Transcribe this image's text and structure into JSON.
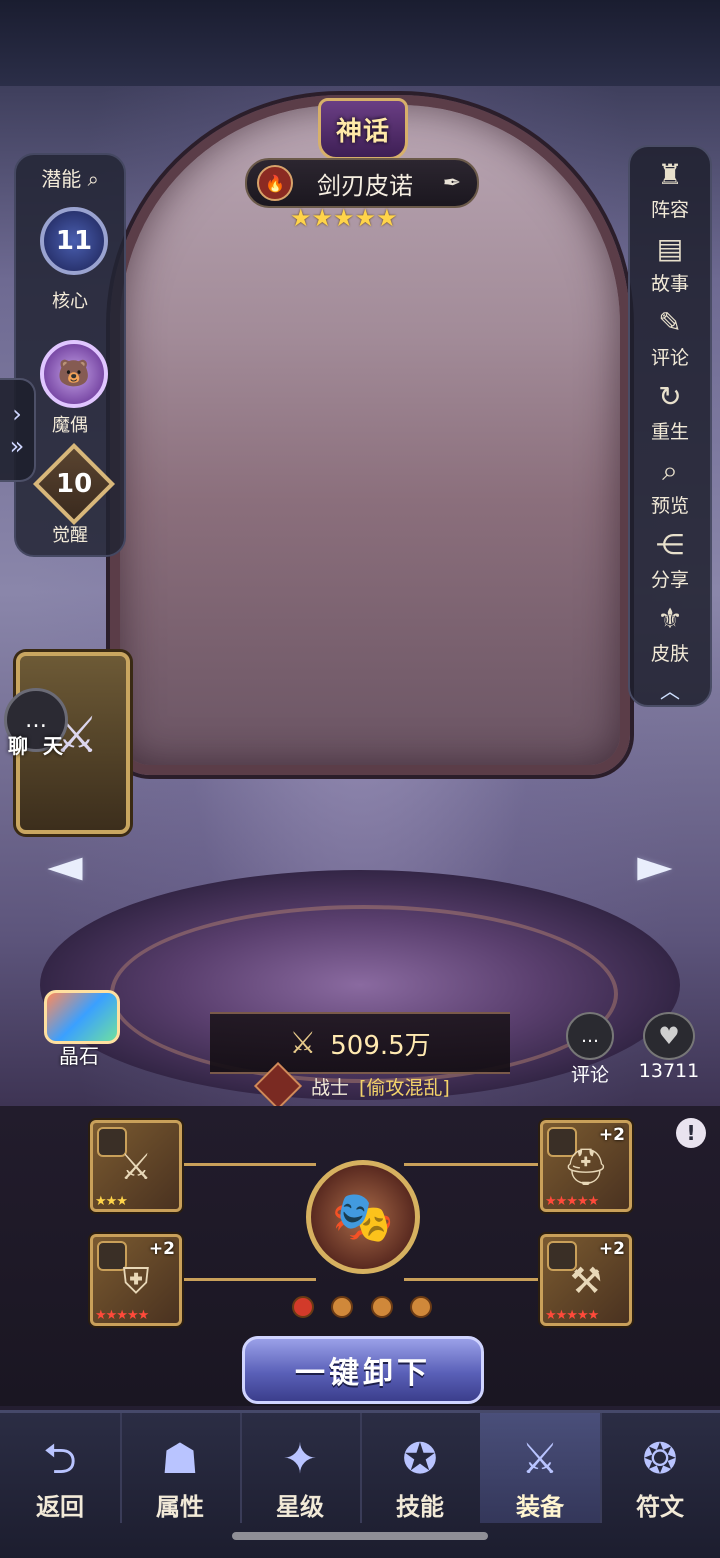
{
  "hero": {
    "rarity": "神话",
    "name": "剑刃皮诺",
    "stars": "★★★★★",
    "power": "509.5万",
    "class": "战士",
    "tag": "[偷攻混乱]"
  },
  "left_panel": {
    "title": "潜能",
    "core_value": "11",
    "core_label": "核心",
    "puppet_label": "魔偶",
    "awaken_value": "10",
    "awaken_label": "觉醒"
  },
  "chat": {
    "label": "聊 天"
  },
  "right_menu": [
    {
      "label": "阵容",
      "icon": "lineup-icon",
      "glyph": "♜"
    },
    {
      "label": "故事",
      "icon": "story-book-icon",
      "glyph": "📖"
    },
    {
      "label": "评论",
      "icon": "quill-icon",
      "glyph": "✎"
    },
    {
      "label": "重生",
      "icon": "rebirth-icon",
      "glyph": "↻"
    },
    {
      "label": "预览",
      "icon": "magnifier-icon",
      "glyph": "🔍"
    },
    {
      "label": "分享",
      "icon": "share-icon",
      "glyph": "⋲"
    },
    {
      "label": "皮肤",
      "icon": "skin-icon",
      "glyph": "⚜"
    }
  ],
  "crystal": {
    "label": "晶石"
  },
  "social": {
    "comment_label": "评论",
    "likes": "13711"
  },
  "equipment": [
    {
      "slot": "weapon",
      "plus": "",
      "stars": "★★★",
      "star_color": "gold"
    },
    {
      "slot": "helmet",
      "plus": "+2",
      "stars": "★★★★★",
      "star_color": "red"
    },
    {
      "slot": "armor",
      "plus": "+2",
      "stars": "★★★★★",
      "star_color": "red"
    },
    {
      "slot": "boots",
      "plus": "+2",
      "stars": "★★★★★",
      "star_color": "red"
    }
  ],
  "unequip_label": "一键卸下",
  "alert_glyph": "!",
  "bottom_nav": [
    {
      "label": "返回",
      "icon": "back-arrow-icon",
      "active": false
    },
    {
      "label": "属性",
      "icon": "hooded-figure-icon",
      "active": false
    },
    {
      "label": "星级",
      "icon": "star-crest-icon",
      "active": false
    },
    {
      "label": "技能",
      "icon": "spellbook-icon",
      "active": false
    },
    {
      "label": "装备",
      "icon": "crossed-swords-icon",
      "active": true
    },
    {
      "label": "符文",
      "icon": "rune-icon",
      "active": false
    }
  ],
  "colors": {
    "accent_gold": "#d6b160",
    "active_tab": "#4a4f7a",
    "star_red": "#ff4a3a",
    "star_gold": "#ffd44a"
  }
}
